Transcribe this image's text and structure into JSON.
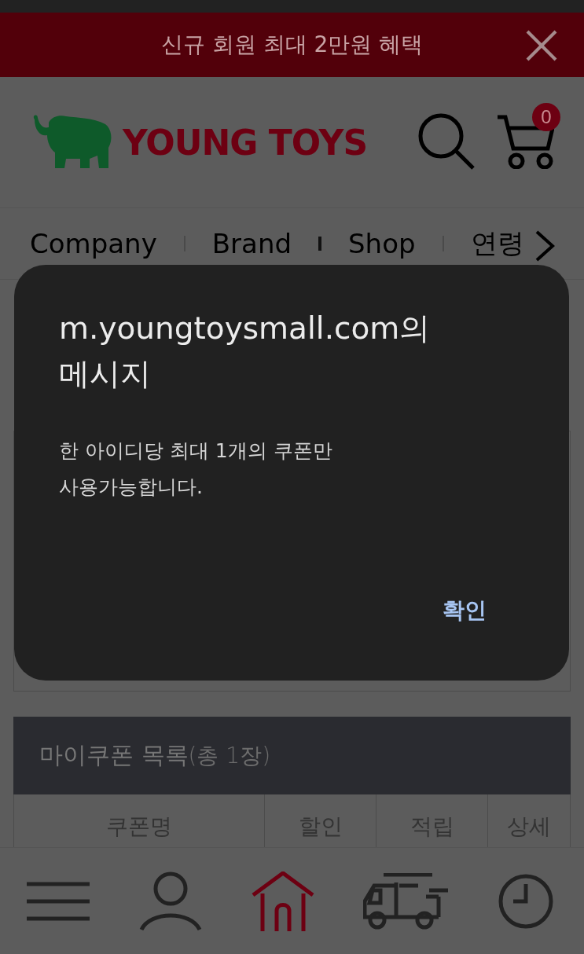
{
  "banner": {
    "text": "신규 회원 최대 2만원 혜택"
  },
  "header": {
    "logo_text": "YOUNG TOYS",
    "cart_count": "0"
  },
  "nav": {
    "items": [
      {
        "label": "Company"
      },
      {
        "label": "Brand"
      },
      {
        "label": "Shop"
      },
      {
        "label": "연령"
      }
    ]
  },
  "dialog": {
    "title": "m.youngtoysmall.com의 메시지",
    "message_lines": [
      "한 아이디당 최대 1개의 쿠폰만",
      "사용가능합니다."
    ],
    "button": "확인"
  },
  "coupon_list": {
    "title": "마이쿠폰 목록",
    "count": "(총 1장)",
    "columns": [
      "쿠폰명",
      "할인",
      "적립",
      "상세"
    ]
  },
  "bottom_nav": [
    {
      "kind": "menu",
      "selected": false
    },
    {
      "kind": "user",
      "selected": false
    },
    {
      "kind": "home",
      "selected": true
    },
    {
      "kind": "truck",
      "selected": false
    },
    {
      "kind": "clock",
      "selected": false
    }
  ]
}
